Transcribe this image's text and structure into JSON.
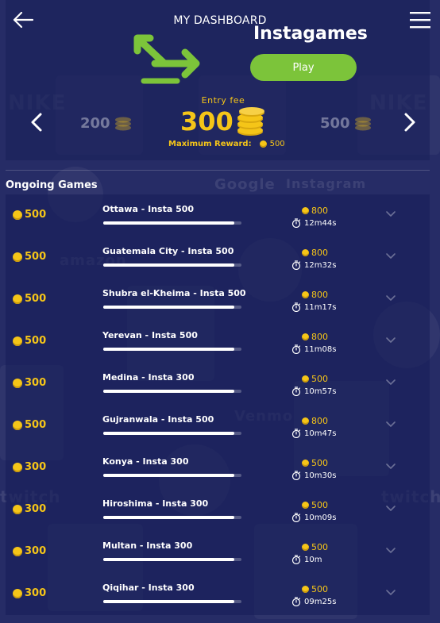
{
  "header": {
    "title": "MY DASHBOARD",
    "back_icon": "arrow-left-icon",
    "menu_icon": "hamburger-menu-icon"
  },
  "game": {
    "title": "Instagames",
    "play_label": "Play",
    "entry_fee_label": "Entry fee",
    "entry_fee": "300",
    "prev_fee": "200",
    "next_fee": "500",
    "max_reward_label": "Maximum Reward:",
    "max_reward": "500"
  },
  "section": {
    "ongoing_title": "Ongoing Games"
  },
  "colors": {
    "accent_gold": "#f5c518",
    "play_green": "#7cc43a",
    "background": "#232a63"
  },
  "games": [
    {
      "fee": "500",
      "name": "Ottawa - Insta 500",
      "reward": "800",
      "time": "12m44s",
      "progress": 0.95
    },
    {
      "fee": "500",
      "name": "Guatemala City - Insta 500",
      "reward": "800",
      "time": "12m32s",
      "progress": 0.95
    },
    {
      "fee": "500",
      "name": "Shubra el-Kheima - Insta 500",
      "reward": "800",
      "time": "11m17s",
      "progress": 0.95
    },
    {
      "fee": "500",
      "name": "Yerevan - Insta 500",
      "reward": "800",
      "time": "11m08s",
      "progress": 0.95
    },
    {
      "fee": "300",
      "name": "Medina - Insta 300",
      "reward": "500",
      "time": "10m57s",
      "progress": 0.95
    },
    {
      "fee": "500",
      "name": "Gujranwala - Insta 500",
      "reward": "800",
      "time": "10m47s",
      "progress": 0.95
    },
    {
      "fee": "300",
      "name": "Konya - Insta 300",
      "reward": "500",
      "time": "10m30s",
      "progress": 0.95
    },
    {
      "fee": "300",
      "name": "Hiroshima - Insta 300",
      "reward": "500",
      "time": "10m09s",
      "progress": 0.95
    },
    {
      "fee": "300",
      "name": "Multan - Insta 300",
      "reward": "500",
      "time": "10m",
      "progress": 0.95
    },
    {
      "fee": "300",
      "name": "Qiqihar - Insta 300",
      "reward": "500",
      "time": "09m25s",
      "progress": 0.95
    }
  ]
}
